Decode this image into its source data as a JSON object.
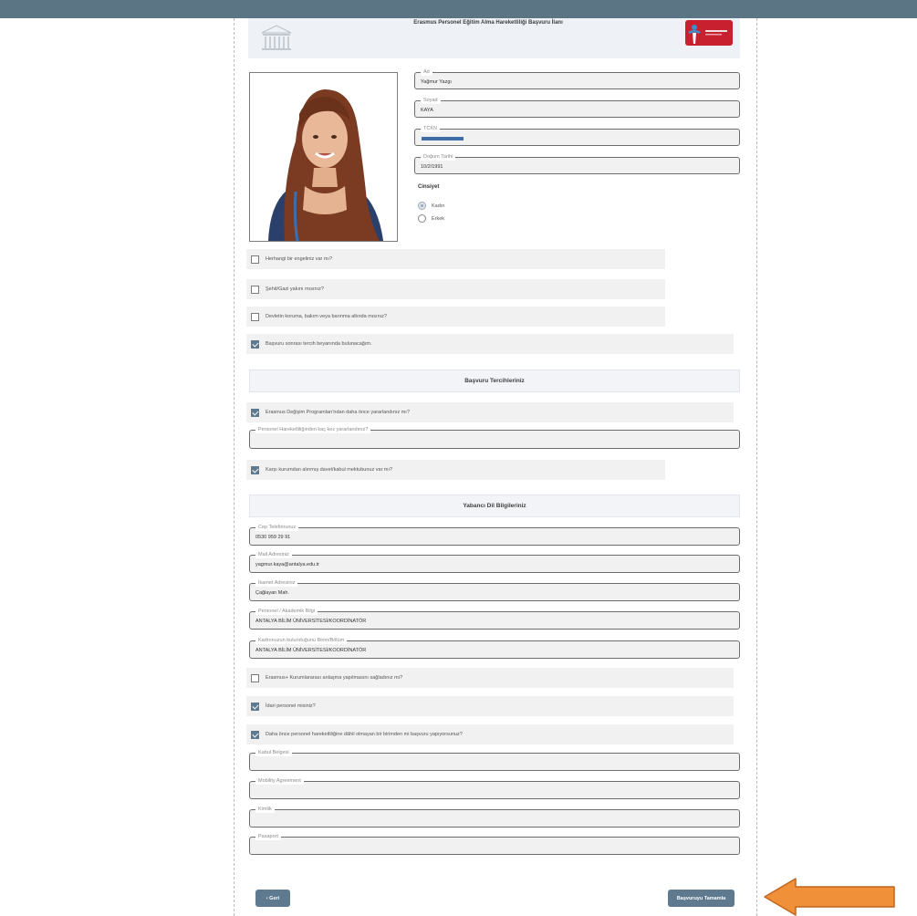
{
  "header": {
    "title": "Erasmus Personel Eğitim Alma Hareketliliği Başvuru İlanı"
  },
  "personal": {
    "ad": {
      "label": "Ad",
      "value": "Yağmur Yazgı"
    },
    "soyad": {
      "label": "Soyad",
      "value": "KAYA"
    },
    "tckn": {
      "label": "TCKN",
      "value": ""
    },
    "dogum": {
      "label": "Doğum Tarihi",
      "value": "10/2/1991"
    }
  },
  "gender": {
    "label": "Cinsiyet",
    "options": [
      {
        "label": "Kadın",
        "selected": true
      },
      {
        "label": "Erkek",
        "selected": false
      }
    ]
  },
  "questions": {
    "engel": {
      "label": "Herhangi bir engeliniz var mı?",
      "checked": false
    },
    "sehit": {
      "label": "Şehit/Gazi yakını mısınız?",
      "checked": false
    },
    "koruma": {
      "label": "Devletin koruma, bakım veya barınma altında mısınız?",
      "checked": false
    },
    "beyan": {
      "label": "Başvuru sonrası tercih beyanında bulunacağım.",
      "checked": true
    }
  },
  "section_tercih": {
    "title": "Başvuru Tercihleriniz"
  },
  "tercih": {
    "erasmus_prev": {
      "label": "Erasmus Değişim Programları'ndan daha önce yararlandınız mı?",
      "checked": true
    },
    "kac_kez": {
      "label": "Personel Hareketliliğinden kaç kez yararlandınız?",
      "value": ""
    },
    "davet": {
      "label": "Karşı kurumdan alınmış davet/kabul mektubunuz var mı?",
      "checked": true
    }
  },
  "section_dil": {
    "title": "Yabancı Dil Bilgileriniz"
  },
  "contact": {
    "cep": {
      "label": "Cep Telefonunuz",
      "value": "0530 959 29 91"
    },
    "mail": {
      "label": "Mail Adresiniz",
      "value": "yagmur.kaya@antalya.edu.tr"
    },
    "ikamet": {
      "label": "İkamet Adresiniz",
      "value": "Çağlayan Mah."
    },
    "akademik": {
      "label": "Personel / Akademik Bilgi",
      "value": "ANTALYA BİLİM ÜNİVERSİTESİ/KOORDİNATÖR"
    },
    "birim": {
      "label": "Kadronuzun bulunduğunu Birim/Bölüm",
      "value": "ANTALYA BİLİM ÜNİVERSİTESİ/KOORDİNATÖR"
    }
  },
  "more_questions": {
    "anlasma": {
      "label": "Erasmus+ Kurumlararası anlaşma yapılmasını sağladınız mı?",
      "checked": false
    },
    "idari": {
      "label": "İdari personel misiniz?",
      "checked": true
    },
    "daha_once": {
      "label": "Daha önce personel hareketliliğine dâhil olmayan bir birimden mi başvuru yapıyorsunuz?",
      "checked": true
    }
  },
  "documents": {
    "kabul": {
      "label": "Kabul Belgesi",
      "value": ""
    },
    "mobility": {
      "label": "Mobility Agreement",
      "value": ""
    },
    "kimlik": {
      "label": "Kimlik",
      "value": ""
    },
    "pasaport": {
      "label": "Pasaport",
      "value": ""
    }
  },
  "buttons": {
    "back": "‹  Geri",
    "submit": "Başvuruyu Tamamla"
  },
  "colors": {
    "topbar": "#5b7585",
    "accent": "#5f7a8f",
    "arrow": "#f0913a",
    "tc_bar": "#3e6ea6"
  }
}
